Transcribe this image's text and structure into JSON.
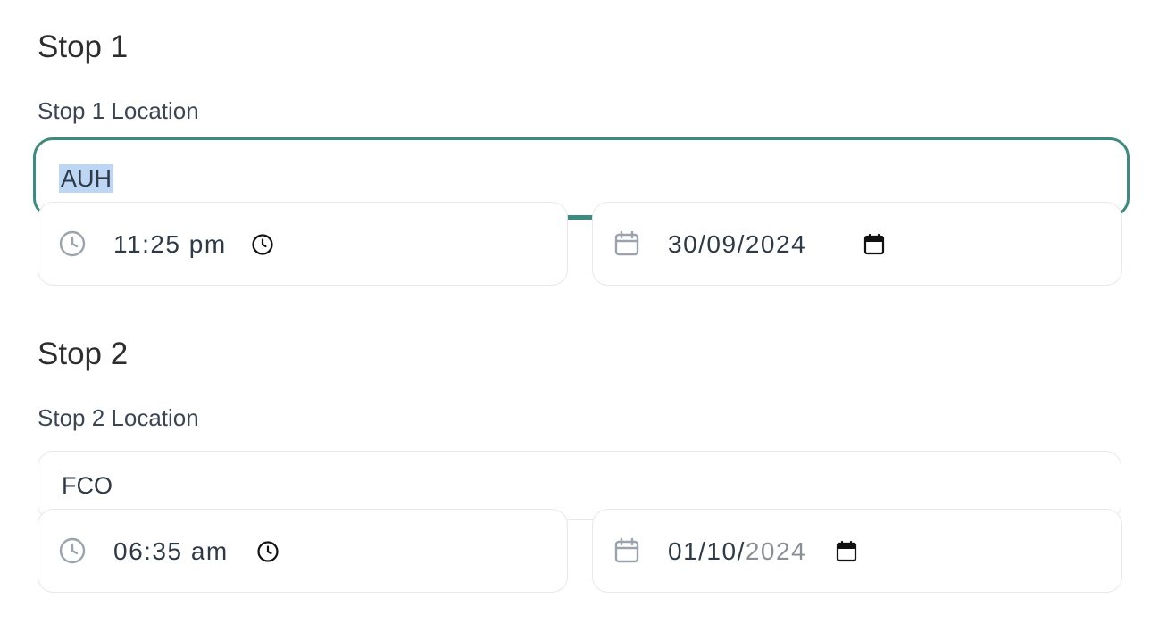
{
  "stops": [
    {
      "title": "Stop 1",
      "location_label": "Stop 1 Location",
      "location_value": "AUH",
      "time_value": "11:25 pm",
      "date_value": "30/09/2024",
      "date_faded": ""
    },
    {
      "title": "Stop 2",
      "location_label": "Stop 2 Location",
      "location_value": "FCO",
      "time_value": "06:35 am",
      "date_value": "01/10/",
      "date_faded": "2024"
    }
  ],
  "colors": {
    "focus_border": "#3d8a80",
    "selection": "#bcd6f4",
    "field_border": "#e8e8ec"
  },
  "icons": {
    "time_leading": "clock-icon",
    "time_trailing": "clock-picker-icon",
    "date_leading": "calendar-icon",
    "date_trailing": "calendar-picker-icon"
  }
}
